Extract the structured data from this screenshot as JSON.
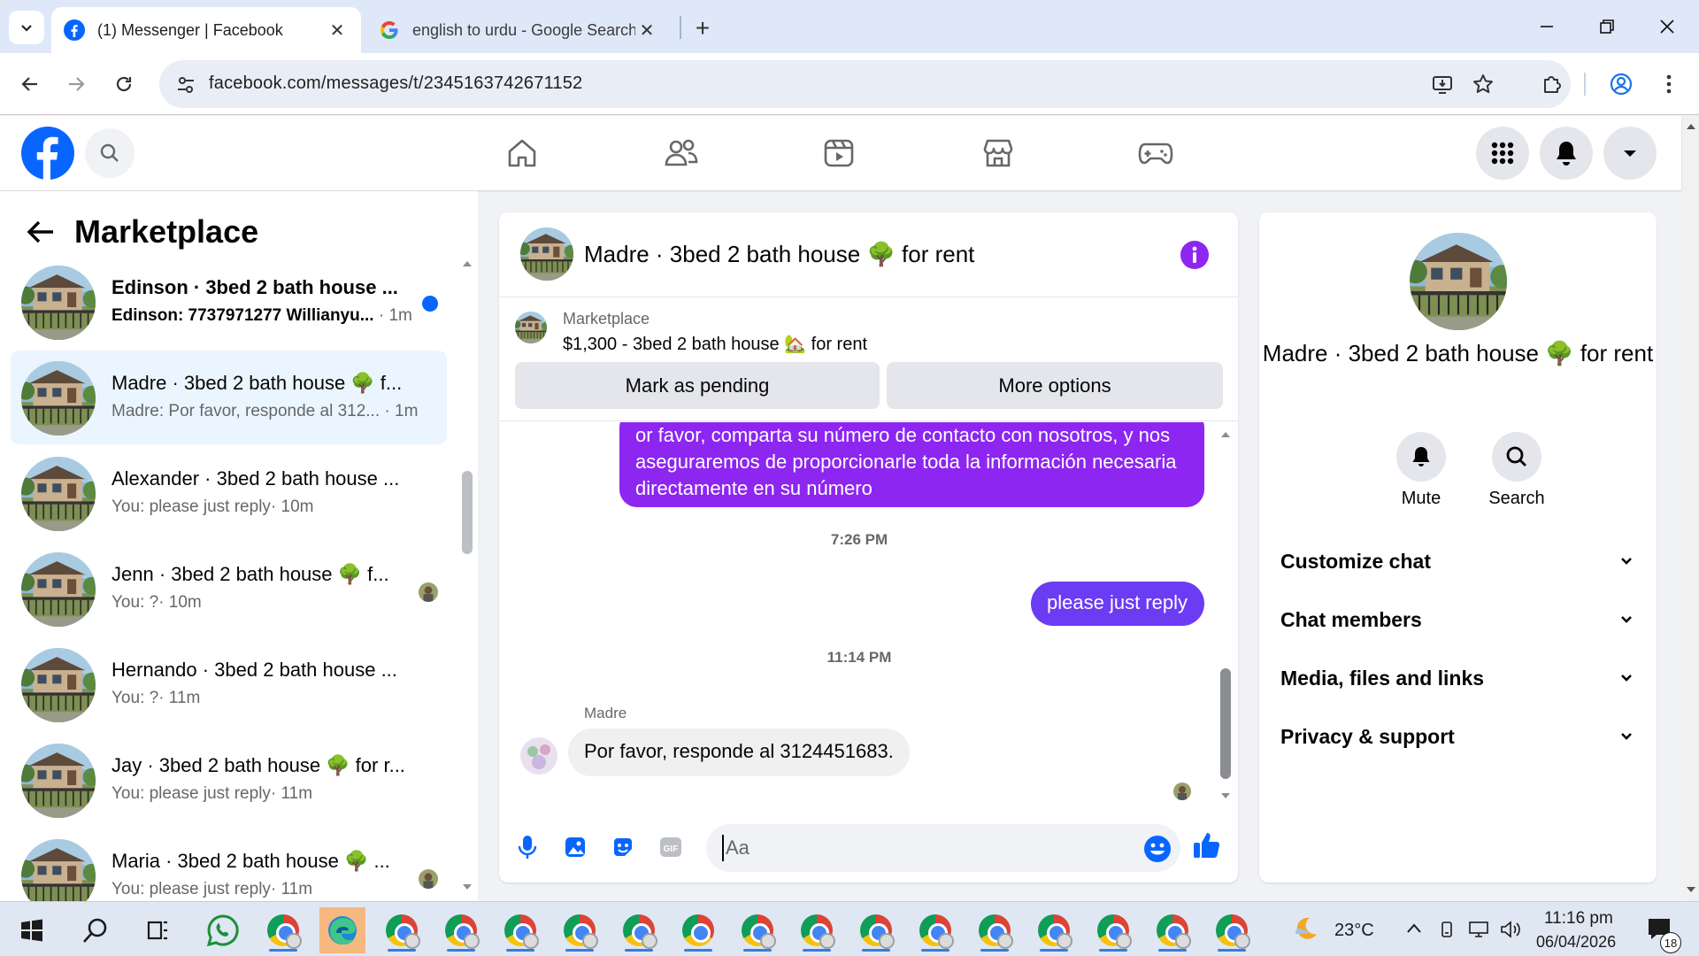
{
  "browser": {
    "tabs": [
      {
        "title": "(1) Messenger | Facebook",
        "active": true
      },
      {
        "title": "english to urdu - Google Search",
        "active": false
      }
    ],
    "url": "facebook.com/messages/t/2345163742671152",
    "colors": {
      "tabstrip": "#dee8f8",
      "omnibox": "#e9eef6"
    }
  },
  "fb": {
    "brand_color": "#0866ff",
    "nav": [
      "home-icon",
      "friends-icon",
      "video-icon",
      "marketplace-icon",
      "gaming-icon"
    ],
    "right": [
      "menu-grid-icon",
      "notifications-bell-icon",
      "account-chevron-icon"
    ]
  },
  "sidebar": {
    "title": "Marketplace",
    "conversations": [
      {
        "name": "Edinson · 3bed 2 bath house ...",
        "snippet": "Edinson: 7737971277 Willianyu...",
        "time": "· 1m",
        "unread": true
      },
      {
        "name": "Madre · 3bed 2 bath house 🌳 f...",
        "snippet": "Madre: Por favor, responde al 312...",
        "time": "· 1m",
        "selected": true
      },
      {
        "name": "Alexander · 3bed 2 bath house ...",
        "snippet": "You: please just reply",
        "time": "· 10m"
      },
      {
        "name": "Jenn · 3bed 2 bath house 🌳 f...",
        "snippet": "You: ?",
        "time": "· 10m"
      },
      {
        "name": "Hernando · 3bed 2 bath house ...",
        "snippet": "You: ?",
        "time": "· 11m"
      },
      {
        "name": "Jay · 3bed 2 bath house 🌳 for r...",
        "snippet": "You: please just reply",
        "time": "· 11m"
      },
      {
        "name": "Maria · 3bed 2 bath house 🌳 ...",
        "snippet": "You: please just reply",
        "time": "· 11m"
      }
    ]
  },
  "conversation": {
    "title": "Madre · 3bed 2 bath house 🌳 for rent",
    "listing": {
      "label": "Marketplace",
      "description": "$1,300 - 3bed 2 bath house 🏡 for rent",
      "mark_pending": "Mark as pending",
      "more_options": "More options"
    },
    "messages": {
      "outgoing_long": "or favor, comparta su número de contacto con nosotros, y nos aseguraremos de proporcionarle toda la información necesaria directamente en su número",
      "time1": "7:26 PM",
      "outgoing_short": "please just reply",
      "time2": "11:14 PM",
      "sender": "Madre",
      "incoming": "Por favor, responde al 3124451683."
    },
    "composer_placeholder": "Aa",
    "accent_color": "#8d26f0"
  },
  "info_panel": {
    "title": "Madre · 3bed 2 bath house 🌳 for rent",
    "mute": "Mute",
    "search": "Search",
    "sections": [
      "Customize chat",
      "Chat members",
      "Media, files and links",
      "Privacy & support"
    ]
  },
  "taskbar": {
    "weather": "23°C",
    "time": "11:16 pm",
    "date": "06/04/2026",
    "notifications": "18"
  }
}
